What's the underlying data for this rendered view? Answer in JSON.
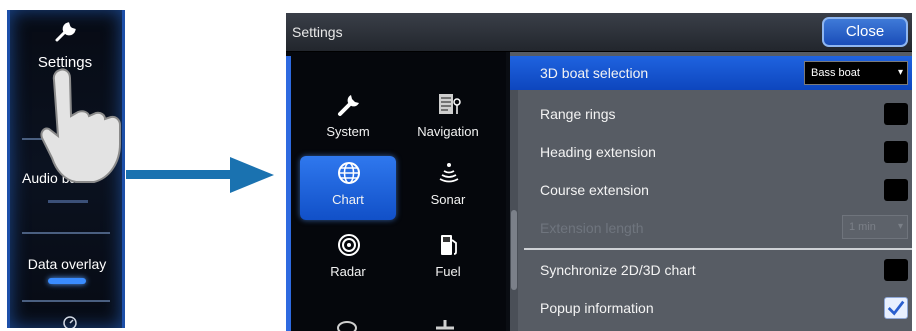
{
  "mini_sidebar": {
    "settings_label": "Settings",
    "audio_label": "Audio bar",
    "data_overlay_label": "Data overlay"
  },
  "window": {
    "title": "Settings",
    "close_label": "Close",
    "categories": [
      {
        "label": "System",
        "icon": "wrench-icon",
        "selected": false
      },
      {
        "label": "Navigation",
        "icon": "navigation-icon",
        "selected": false
      },
      {
        "label": "Chart",
        "icon": "globe-icon",
        "selected": true
      },
      {
        "label": "Sonar",
        "icon": "sonar-icon",
        "selected": false
      },
      {
        "label": "Radar",
        "icon": "radar-icon",
        "selected": false
      },
      {
        "label": "Fuel",
        "icon": "fuel-pump-icon",
        "selected": false
      }
    ],
    "settings_rows": {
      "boat_selection": {
        "label": "3D boat selection",
        "value": "Bass boat"
      },
      "range_rings": {
        "label": "Range rings",
        "checked": false
      },
      "heading_extension": {
        "label": "Heading extension",
        "checked": false
      },
      "course_extension": {
        "label": "Course extension",
        "checked": false
      },
      "extension_length": {
        "label": "Extension length",
        "value": "1 min",
        "disabled": true
      },
      "synchronize": {
        "label": "Synchronize 2D/3D chart",
        "checked": false
      },
      "popup_information": {
        "label": "Popup information",
        "checked": true
      }
    }
  },
  "colors": {
    "accent_blue": "#1f63e0",
    "panel_gray": "#575c64",
    "arrow_blue": "#1a72b0"
  }
}
